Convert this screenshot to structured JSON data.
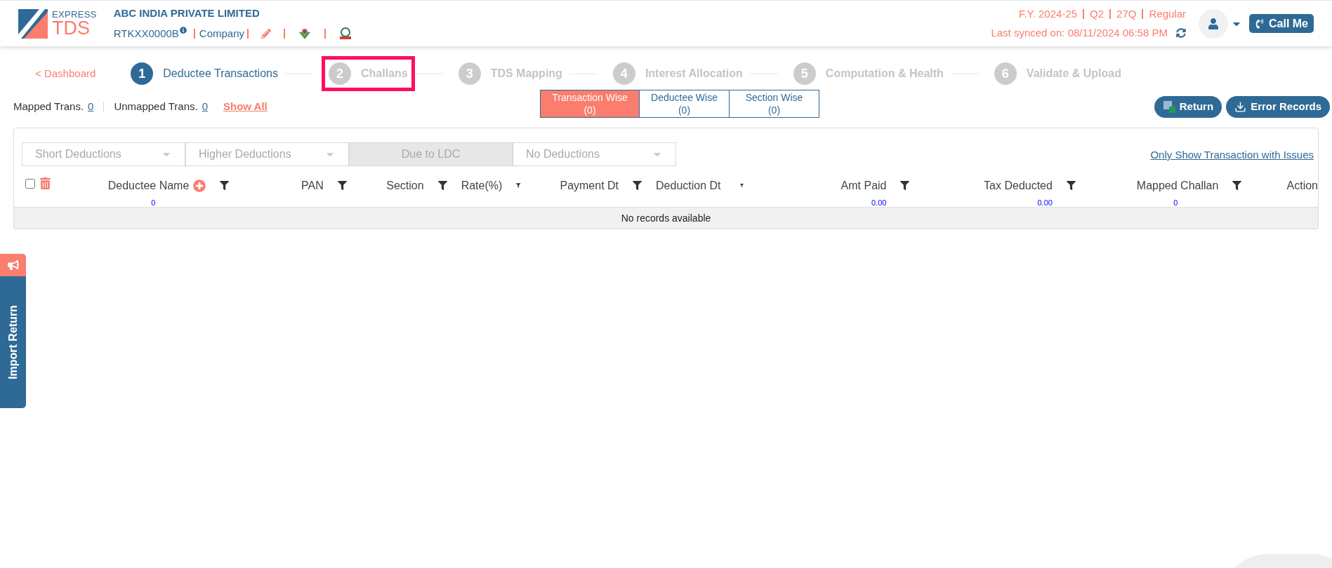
{
  "header": {
    "logo": {
      "line1": "EXPRESS",
      "line2": "TDS"
    },
    "company": "ABC INDIA PRIVATE LIMITED",
    "tan": "RTKXX0000B",
    "entity": "Company",
    "period": [
      "F.Y. 2024-25",
      "Q2",
      "27Q",
      "Regular"
    ],
    "last_synced": "Last synced on: 08/11/2024 06:58 PM",
    "call_button": "Call Me"
  },
  "back_link": "< Dashboard",
  "steps": [
    {
      "number": "1",
      "label": "Deductee Transactions",
      "selected": true,
      "highlighted": false
    },
    {
      "number": "2",
      "label": "Challans",
      "selected": false,
      "highlighted": true
    },
    {
      "number": "3",
      "label": "TDS Mapping",
      "selected": false,
      "highlighted": false
    },
    {
      "number": "4",
      "label": "Interest Allocation",
      "selected": false,
      "highlighted": false
    },
    {
      "number": "5",
      "label": "Computation & Health",
      "selected": false,
      "highlighted": false
    },
    {
      "number": "6",
      "label": "Validate & Upload",
      "selected": false,
      "highlighted": false
    }
  ],
  "counts": [
    {
      "label": "Mapped Trans.",
      "value": "0"
    },
    {
      "label": "Unmapped Trans.",
      "value": "0"
    }
  ],
  "show_all": "Show All",
  "view_tabs": [
    {
      "label": "Transaction Wise",
      "count": "(0)",
      "selected": true
    },
    {
      "label": "Deductee Wise",
      "count": "(0)",
      "selected": false
    },
    {
      "label": "Section Wise",
      "count": "(0)",
      "selected": false
    }
  ],
  "action_buttons": [
    {
      "kind": "excel",
      "label": "Return"
    },
    {
      "kind": "download",
      "label": "Error Records"
    }
  ],
  "filters": [
    {
      "kind": "select",
      "label": "Short Deductions",
      "disabled": false
    },
    {
      "kind": "select",
      "label": "Higher Deductions",
      "disabled": false
    },
    {
      "kind": "button",
      "label": "Due to LDC",
      "disabled": true
    },
    {
      "kind": "select",
      "label": "No Deductions",
      "disabled": false
    }
  ],
  "issues_link": "Only Show Transaction with Issues",
  "table": {
    "select_all_checked": false,
    "columns": [
      {
        "label": "Deductee Name",
        "total": "0",
        "addable": true,
        "filterable": true
      },
      {
        "label": "PAN",
        "filterable": true
      },
      {
        "label": "Section",
        "filterable": true
      },
      {
        "label": "Rate(%)",
        "filterable": true
      },
      {
        "label": "Payment Dt",
        "filterable": true
      },
      {
        "label": "Deduction Dt",
        "filterable": true
      },
      {
        "label": "Amt Paid",
        "total": "0.00",
        "filterable": true
      },
      {
        "label": "Tax Deducted",
        "total": "0.00",
        "filterable": true
      },
      {
        "label": "Mapped Challan",
        "total": "0",
        "filterable": true
      },
      {
        "label": "Action",
        "filterable": false
      }
    ],
    "empty_message": "No records available"
  },
  "side_tab": {
    "label": "Import Return"
  }
}
